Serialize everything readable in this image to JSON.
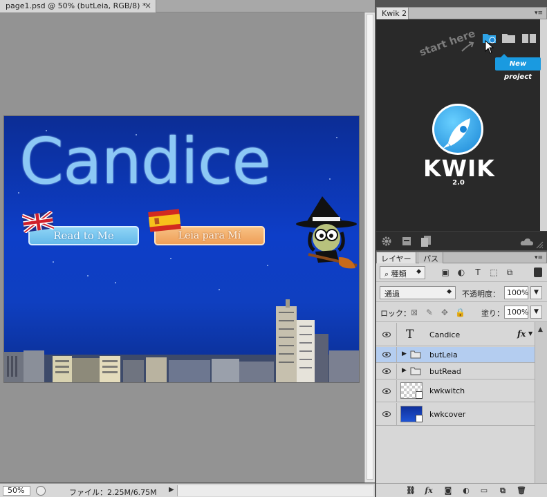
{
  "document": {
    "tab_title": "page1.psd @ 50% (butLeia, RGB/8) *",
    "close_glyph": "×",
    "artwork": {
      "title": "Candice",
      "read_button": "Read to Me",
      "leia_button": "Leia para Mí"
    }
  },
  "statusbar": {
    "zoom": "50%",
    "file_info": "ファイル：2.25M/6.75M",
    "arrow_glyph": "▶"
  },
  "kwik_panel": {
    "tab_label": "Kwik 2",
    "start_here": "start here",
    "tooltip": "New project",
    "logo_text": "KWIK",
    "version": "2.0",
    "icons": [
      "new-project-icon",
      "open-folder-icon",
      "book-icon",
      "gear-icon",
      "print-icon",
      "pages-icon",
      "cloud-icon"
    ],
    "accent_color": "#1a9ae0"
  },
  "layers_panel": {
    "tabs": [
      "レイヤー",
      "パス"
    ],
    "filter_kind": "種類",
    "blend_mode": "通過",
    "opacity_label": "不透明度：",
    "opacity_value": "100%",
    "lock_label": "ロック：",
    "fill_label": "塗り：",
    "fill_value": "100%",
    "layers": [
      {
        "name": "Candice",
        "kind": "text",
        "fx": "fx",
        "selected": false
      },
      {
        "name": "butLeia",
        "kind": "group",
        "selected": true
      },
      {
        "name": "butRead",
        "kind": "group",
        "selected": false
      },
      {
        "name": "kwkwitch",
        "kind": "smart",
        "selected": false
      },
      {
        "name": "kwkcover",
        "kind": "smart",
        "selected": false
      }
    ],
    "footer_icons": [
      "link-icon",
      "fx-icon",
      "mask-icon",
      "adjustment-icon",
      "folder-icon",
      "new-layer-icon",
      "trash-icon"
    ],
    "selection_color": "#b4cdf0"
  }
}
